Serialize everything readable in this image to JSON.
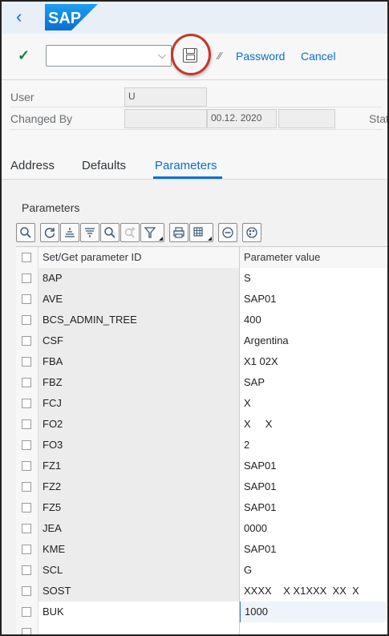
{
  "header": {
    "back_glyph": "‹",
    "logo": "SAP"
  },
  "toolbar": {
    "select_value": "",
    "password_label": "Password",
    "cancel_label": "Cancel"
  },
  "user_info": {
    "user_label": "User",
    "user_value": "U",
    "changed_by_label": "Changed By",
    "changed_by_value": "",
    "changed_date": "00.12. 2020",
    "changed_time": "",
    "status_label": "Stat"
  },
  "tabs": [
    {
      "label": "Address"
    },
    {
      "label": "Defaults"
    },
    {
      "label": "Parameters",
      "active": true
    }
  ],
  "section": {
    "title": "Parameters"
  },
  "grid_toolbar_icons": [
    "zoom-icon",
    "refresh-icon",
    "sort-ascending-icon",
    "sort-descending-icon",
    "find-icon",
    "find-next-icon",
    "filter-icon",
    "print-icon",
    "export-icon",
    "delete-row-icon",
    "settings-icon"
  ],
  "table": {
    "columns": [
      "Set/Get parameter ID",
      "Parameter value"
    ],
    "rows": [
      [
        "8AP",
        "S"
      ],
      [
        "AVE",
        "SAP01"
      ],
      [
        "BCS_ADMIN_TREE",
        "400"
      ],
      [
        "CSF",
        "Argentina"
      ],
      [
        "FBA",
        "X1 02X"
      ],
      [
        "FBZ",
        "SAP"
      ],
      [
        "FCJ",
        "X"
      ],
      [
        "FO2",
        "X     X"
      ],
      [
        "FO3",
        "2"
      ],
      [
        "FZ1",
        "SAP01"
      ],
      [
        "FZ2",
        "SAP01"
      ],
      [
        "FZ5",
        "SAP01"
      ],
      [
        "JEA",
        "0000"
      ],
      [
        "KME",
        "SAP01"
      ],
      [
        "SCL",
        "G"
      ],
      [
        "SOST",
        "XXXX    X X1XXX  XX  X"
      ],
      [
        "BUK",
        "1000"
      ]
    ]
  },
  "colors": {
    "accent": "#0a6ed1",
    "shell_bg": "#e8eff6",
    "highlight_ring": "#c0392b",
    "confirm_green": "#107e3e"
  }
}
